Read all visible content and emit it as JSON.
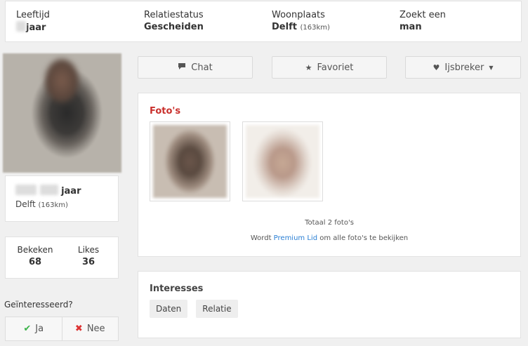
{
  "profile": {
    "age_label": "Leeftijd",
    "age_value": "jaar",
    "relation_label": "Relatiestatus",
    "relation_value": "Gescheiden",
    "city_label": "Woonplaats",
    "city_value": "Delft",
    "city_distance": "(163km)",
    "seeking_label": "Zoekt een",
    "seeking_value": "man"
  },
  "sidebar": {
    "name_suffix": "jaar",
    "location": "Delft",
    "location_distance": "(163km)",
    "viewed_label": "Bekeken",
    "viewed_value": "68",
    "likes_label": "Likes",
    "likes_value": "36",
    "interested_label": "Geïnteresseerd?",
    "yes_label": "Ja",
    "no_label": "Nee"
  },
  "actions": {
    "chat_label": "Chat",
    "favorite_label": "Favoriet",
    "icebreaker_label": "Ijsbreker"
  },
  "photos": {
    "title": "Foto's",
    "total_text": "Totaal 2 foto's",
    "premium_prefix": "Wordt",
    "premium_link": "Premium Lid",
    "premium_suffix": "om alle foto's te bekijken"
  },
  "interests": {
    "title": "Interesses",
    "tags": [
      "Daten",
      "Relatie"
    ]
  },
  "colors": {
    "accent_red": "#c9302c",
    "link_blue": "#2a7fd4",
    "yes_green": "#3cb34a",
    "no_red": "#dd3333"
  }
}
